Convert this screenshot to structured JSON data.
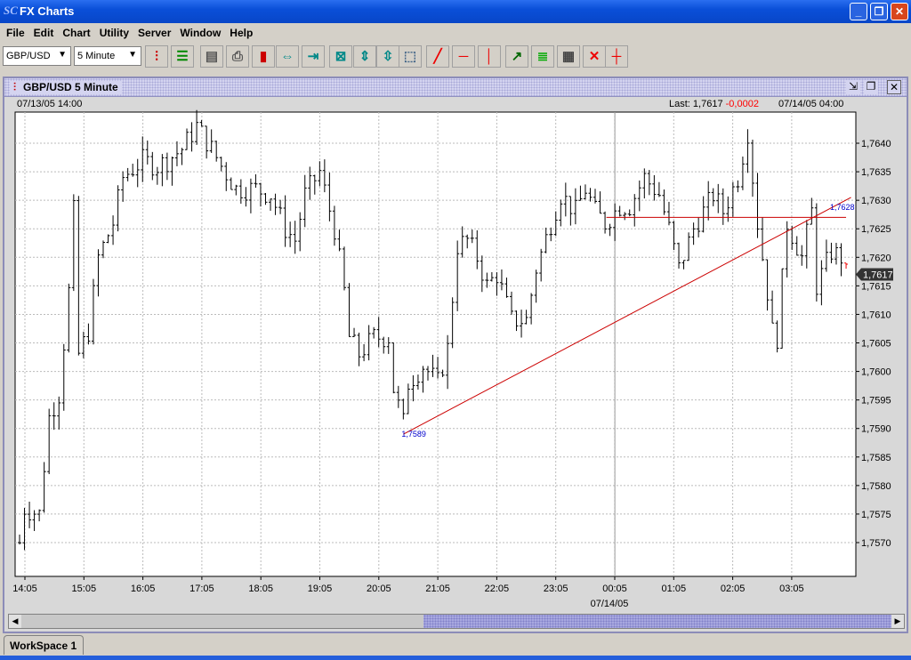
{
  "window": {
    "title": "FX Charts",
    "logo": "SC",
    "controls": [
      "minimize",
      "maximize",
      "close"
    ]
  },
  "menu": [
    "File",
    "Edit",
    "Chart",
    "Utility",
    "Server",
    "Window",
    "Help"
  ],
  "toolbar": {
    "symbol": "GBP/USD",
    "interval": "5 Minute",
    "buttons": [
      "bar-chart-icon",
      "list-icon",
      "server-icon",
      "print-icon",
      "candlestick-icon",
      "expand-horizontal-icon",
      "compress-horizontal-icon",
      "fit-icon",
      "expand-vertical-icon",
      "compress-vertical-icon",
      "zoom-select-icon",
      "trend-line-icon",
      "horizontal-line-icon",
      "vertical-line-icon",
      "indicator-icon",
      "fibonacci-icon",
      "grid-icon",
      "delete-icon",
      "crosshair-icon"
    ]
  },
  "chart_window": {
    "title": "GBP/USD 5 Minute",
    "start": "07/13/05 14:00",
    "last_label": "Last:",
    "last": "1,7617",
    "change": "-0,0002",
    "end": "07/14/05 04:00",
    "date_label": "07/14/05"
  },
  "workspace_tab": "WorkSpace 1",
  "colors": {
    "bars": "#000000",
    "trendline": "#cc0000",
    "label": "#0000cc",
    "change": "#ff0000"
  },
  "chart_data": {
    "type": "ohlc",
    "ylim": [
      1.7564,
      1.7648
    ],
    "yticks": [
      "1,7570",
      "1,7575",
      "1,7580",
      "1,7585",
      "1,7590",
      "1,7595",
      "1,7600",
      "1,7605",
      "1,7610",
      "1,7615",
      "1,7620",
      "1,7625",
      "1,7630",
      "1,7635",
      "1,7640"
    ],
    "xticks": [
      "14:05",
      "15:05",
      "16:05",
      "17:05",
      "18:05",
      "19:05",
      "20:05",
      "21:05",
      "22:05",
      "23:05",
      "00:05",
      "01:05",
      "02:05",
      "03:05"
    ],
    "bar_count": 169,
    "close_keyframes": [
      [
        0,
        1.757
      ],
      [
        1,
        1.7576
      ],
      [
        4,
        1.7575
      ],
      [
        6,
        1.7592
      ],
      [
        8,
        1.7596
      ],
      [
        10,
        1.7614
      ],
      [
        11,
        1.7628
      ],
      [
        12,
        1.7603
      ],
      [
        14,
        1.7607
      ],
      [
        16,
        1.762
      ],
      [
        19,
        1.7626
      ],
      [
        21,
        1.7634
      ],
      [
        25,
        1.7637
      ],
      [
        28,
        1.7636
      ],
      [
        30,
        1.7637
      ],
      [
        33,
        1.7639
      ],
      [
        36,
        1.7643
      ],
      [
        39,
        1.7639
      ],
      [
        41,
        1.7636
      ],
      [
        44,
        1.7632
      ],
      [
        48,
        1.7632
      ],
      [
        51,
        1.7631
      ],
      [
        54,
        1.7625
      ],
      [
        56,
        1.7623
      ],
      [
        58,
        1.7631
      ],
      [
        61,
        1.7635
      ],
      [
        64,
        1.7625
      ],
      [
        66,
        1.7614
      ],
      [
        67,
        1.7606
      ],
      [
        69,
        1.7603
      ],
      [
        72,
        1.7606
      ],
      [
        75,
        1.7606
      ],
      [
        76,
        1.7597
      ],
      [
        78,
        1.7591
      ],
      [
        79,
        1.7598
      ],
      [
        82,
        1.7601
      ],
      [
        85,
        1.7598
      ],
      [
        87,
        1.7604
      ],
      [
        89,
        1.7622
      ],
      [
        91,
        1.7623
      ],
      [
        93,
        1.762
      ],
      [
        95,
        1.7615
      ],
      [
        97,
        1.7617
      ],
      [
        100,
        1.7609
      ],
      [
        103,
        1.7609
      ],
      [
        105,
        1.7618
      ],
      [
        108,
        1.7626
      ],
      [
        110,
        1.7631
      ],
      [
        113,
        1.7628
      ],
      [
        115,
        1.7632
      ],
      [
        117,
        1.7628
      ],
      [
        119,
        1.7626
      ],
      [
        122,
        1.7629
      ],
      [
        124,
        1.7629
      ],
      [
        127,
        1.7634
      ],
      [
        130,
        1.7631
      ],
      [
        132,
        1.7625
      ],
      [
        134,
        1.7618
      ],
      [
        137,
        1.7625
      ],
      [
        141,
        1.7631
      ],
      [
        143,
        1.7628
      ],
      [
        146,
        1.7634
      ],
      [
        148,
        1.7642
      ],
      [
        150,
        1.7626
      ],
      [
        152,
        1.7614
      ],
      [
        153,
        1.7607
      ],
      [
        154,
        1.7606
      ],
      [
        156,
        1.7626
      ],
      [
        159,
        1.762
      ],
      [
        161,
        1.7628
      ],
      [
        162,
        1.7615
      ],
      [
        165,
        1.7621
      ],
      [
        167,
        1.762
      ],
      [
        168,
        1.7617
      ]
    ],
    "trendline": {
      "from": [
        78,
        1.7589
      ],
      "to": [
        169,
        1.76305
      ],
      "label": "1,7589",
      "end_label": "1,7628"
    },
    "hline": {
      "from": 120,
      "to": 168,
      "value": 1.7627
    },
    "day_separator": 121
  }
}
